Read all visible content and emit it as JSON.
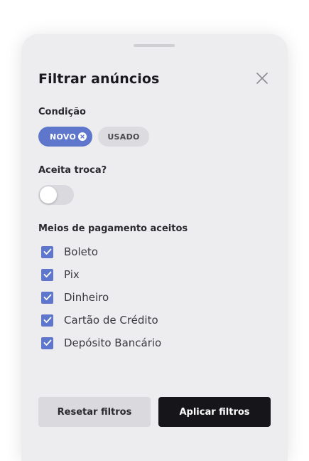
{
  "sheet": {
    "title": "Filtrar anúncios",
    "close_icon": "close-icon"
  },
  "condicao": {
    "label": "Condição",
    "chips": [
      {
        "label": "NOVO",
        "selected": true
      },
      {
        "label": "USADO",
        "selected": false
      }
    ]
  },
  "troca": {
    "label": "Aceita troca?",
    "enabled": false
  },
  "pagamento": {
    "label": "Meios de pagamento aceitos",
    "items": [
      {
        "label": "Boleto",
        "checked": true
      },
      {
        "label": "Pix",
        "checked": true
      },
      {
        "label": "Dinheiro",
        "checked": true
      },
      {
        "label": "Cartão de Crédito",
        "checked": true
      },
      {
        "label": "Depósito Bancário",
        "checked": true
      }
    ]
  },
  "actions": {
    "reset_label": "Resetar filtros",
    "apply_label": "Aplicar filtros"
  },
  "colors": {
    "accent": "#5e77cc",
    "primary_button": "#16161a",
    "sheet_background": "#ededf0"
  }
}
